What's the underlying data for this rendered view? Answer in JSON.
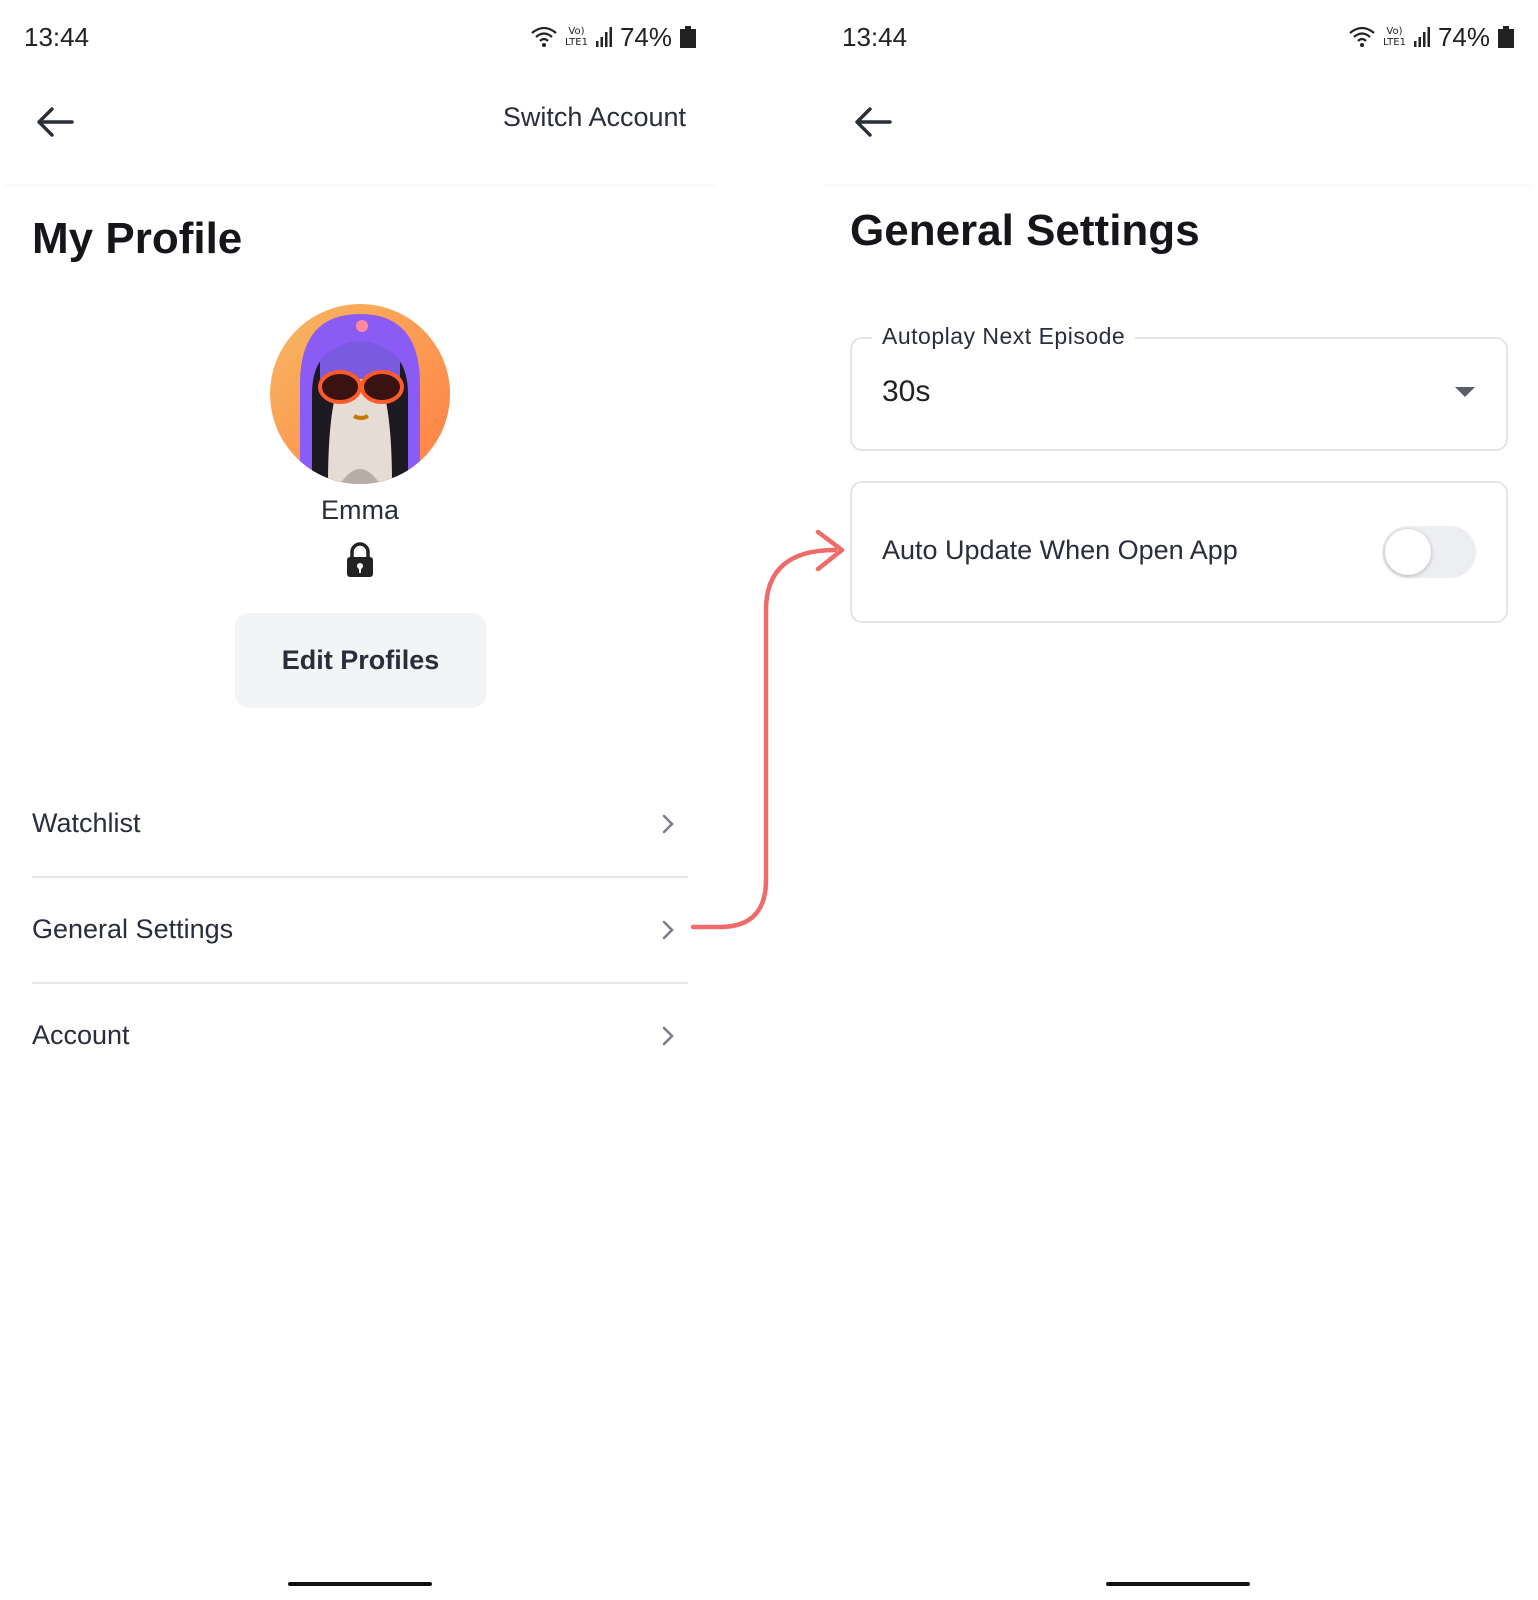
{
  "colors": {
    "arrow": "#f06a6a",
    "text_primary": "#2a2d3a",
    "button_bg": "#f3f4f6"
  },
  "left_screen": {
    "status": {
      "time": "13:44",
      "battery": "74%"
    },
    "appbar": {
      "switch_account_label": "Switch Account"
    },
    "title": "My Profile",
    "profile": {
      "name": "Emma",
      "avatar_icon": "avatar-icon",
      "lock_icon": "lock-icon"
    },
    "edit_button_label": "Edit Profiles",
    "menu": [
      {
        "label": "Watchlist"
      },
      {
        "label": "General Settings"
      },
      {
        "label": "Account"
      }
    ]
  },
  "right_screen": {
    "status": {
      "time": "13:44",
      "battery": "74%"
    },
    "title": "General Settings",
    "autoplay": {
      "legend": "Autoplay Next Episode",
      "value": "30s"
    },
    "auto_update": {
      "label": "Auto Update When Open App",
      "enabled": false
    }
  }
}
